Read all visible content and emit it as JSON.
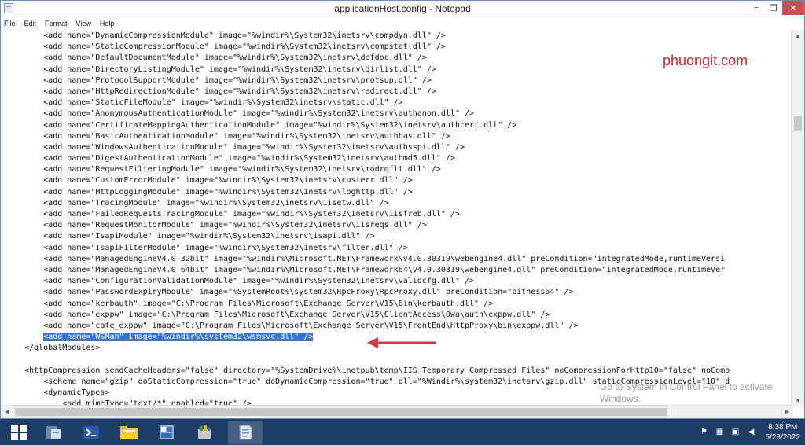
{
  "window": {
    "title": "applicationHost.config - Notepad",
    "min": "−",
    "max": "❐",
    "close": "✕"
  },
  "menu": [
    "File",
    "Edit",
    "Format",
    "View",
    "Help"
  ],
  "lines": [
    "        <add name=\"DynamicCompressionModule\" image=\"%windir%\\System32\\inetsrv\\compdyn.dll\" />",
    "        <add name=\"StaticCompressionModule\" image=\"%windir%\\System32\\inetsrv\\compstat.dll\" />",
    "        <add name=\"DefaultDocumentModule\" image=\"%windir%\\System32\\inetsrv\\defdoc.dll\" />",
    "        <add name=\"DirectoryListingModule\" image=\"%windir%\\System32\\inetsrv\\dirlist.dll\" />",
    "        <add name=\"ProtocolSupportModule\" image=\"%windir%\\System32\\inetsrv\\protsup.dll\" />",
    "        <add name=\"HttpRedirectionModule\" image=\"%windir%\\System32\\inetsrv\\redirect.dll\" />",
    "        <add name=\"StaticFileModule\" image=\"%windir%\\System32\\inetsrv\\static.dll\" />",
    "        <add name=\"AnonymousAuthenticationModule\" image=\"%windir%\\System32\\inetsrv\\authanon.dll\" />",
    "        <add name=\"CertificateMappingAuthenticationModule\" image=\"%windir%\\System32\\inetsrv\\authcert.dll\" />",
    "        <add name=\"BasicAuthenticationModule\" image=\"%windir%\\System32\\inetsrv\\authbas.dll\" />",
    "        <add name=\"WindowsAuthenticationModule\" image=\"%windir%\\System32\\inetsrv\\authsspi.dll\" />",
    "        <add name=\"DigestAuthenticationModule\" image=\"%windir%\\System32\\inetsrv\\authmd5.dll\" />",
    "        <add name=\"RequestFilteringModule\" image=\"%windir%\\System32\\inetsrv\\modrqflt.dll\" />",
    "        <add name=\"CustomErrorModule\" image=\"%windir%\\System32\\inetsrv\\custerr.dll\" />",
    "        <add name=\"HttpLoggingModule\" image=\"%windir%\\System32\\inetsrv\\loghttp.dll\" />",
    "        <add name=\"TracingModule\" image=\"%windir%\\System32\\inetsrv\\iisetw.dll\" />",
    "        <add name=\"FailedRequestsTracingModule\" image=\"%windir%\\System32\\inetsrv\\iisfreb.dll\" />",
    "        <add name=\"RequestMonitorModule\" image=\"%windir%\\System32\\inetsrv\\iisreqs.dll\" />",
    "        <add name=\"IsapiModule\" image=\"%windir%\\System32\\inetsrv\\isapi.dll\" />",
    "        <add name=\"IsapiFilterModule\" image=\"%windir%\\System32\\inetsrv\\filter.dll\" />",
    "        <add name=\"ManagedEngineV4.0_32bit\" image=\"%windir%\\Microsoft.NET\\Framework\\v4.0.30319\\webengine4.dll\" preCondition=\"integratedMode,runtimeVersi",
    "        <add name=\"ManagedEngineV4.0_64bit\" image=\"%windir%\\Microsoft.NET\\Framework64\\v4.0.30319\\webengine4.dll\" preCondition=\"integratedMode,runtimeVer",
    "        <add name=\"ConfigurationValidationModule\" image=\"%windir%\\System32\\inetsrv\\validcfg.dll\" />",
    "        <add name=\"PasswordExpiryModule\" image=\"%SystemRoot%\\system32\\RpcProxy\\RpcProxy.dll\" preCondition=\"bitness64\" />",
    "        <add name=\"kerbauth\" image=\"C:\\Program Files\\Microsoft\\Exchange Server\\V15\\Bin\\kerbauth.dll\" />",
    "        <add name=\"exppw\" image=\"C:\\Program Files\\Microsoft\\Exchange Server\\V15\\ClientAccess\\Owa\\auth\\exppw.dll\" />",
    "        <add name=\"cafe_exppw\" image=\"C:\\Program Files\\Microsoft\\Exchange Server\\V15\\FrontEnd\\HttpProxy\\bin\\exppw.dll\" />",
    "        <add name=\"WSMan\" image=\"%windir%\\system32\\wsmsvc.dll\" />",
    "    </globalModules>",
    "",
    "    <httpCompression sendCacheHeaders=\"false\" directory=\"%SystemDrive%\\inetpub\\temp\\IIS Temporary Compressed Files\" noCompressionForHttp10=\"false\" noComp",
    "        <scheme name=\"gzip\" doStaticCompression=\"true\" doDynamicCompression=\"true\" dll=\"%Windir%\\system32\\inetsrv\\gzip.dll\" staticCompressionLevel=\"10\" d",
    "        <dynamicTypes>",
    "            <add mimeType=\"text/*\" enabled=\"true\" />"
  ],
  "highlight_index": 27,
  "watermark": "phuongit.com",
  "activation": {
    "line1": "Go to System in Control Panel to activate",
    "line2": "Windows."
  },
  "clock": {
    "time": "8:38 PM",
    "date": "5/28/2022"
  },
  "taskbar": [
    "windows-start-icon",
    "server-manager-icon",
    "powershell-icon",
    "file-explorer-icon",
    "server-config-icon",
    "iis-manager-icon",
    "notepad-icon"
  ]
}
